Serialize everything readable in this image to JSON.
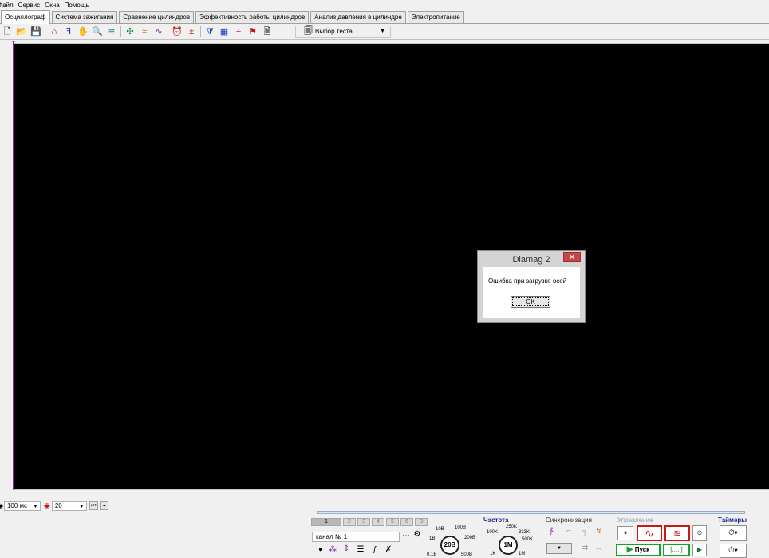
{
  "menu": [
    "Файл",
    "Сервис",
    "Окна",
    "Помощь"
  ],
  "tabs": [
    {
      "label": "Осциллограф",
      "active": true
    },
    {
      "label": "Система зажигания",
      "active": false
    },
    {
      "label": "Сравнение цилиндров",
      "active": false
    },
    {
      "label": "Эффективность работы цилиндров",
      "active": false
    },
    {
      "label": "Анализ давления в цилиндре",
      "active": false
    },
    {
      "label": "Электропитание",
      "active": false
    }
  ],
  "toolbar": {
    "test_select": "Выбор теста",
    "icons": [
      "new-file-icon",
      "open-folder-icon",
      "save-icon",
      "headphones-icon",
      "cursor-probe-icon",
      "hand-icon",
      "zoom-icon",
      "spring-icon",
      "crosshair-icon",
      "waves-icon",
      "sine-icon",
      "alarm-icon",
      "level-icon",
      "filter-icon",
      "grid-icon",
      "split-icon",
      "flag-icon",
      "document-icon"
    ]
  },
  "timebar": {
    "time_value": "100 мс",
    "count_value": "20"
  },
  "dialog": {
    "title": "Diamag 2",
    "close_glyph": "✕",
    "message": "Ошибка при загрузке осей",
    "ok_label": "OK"
  },
  "panel": {
    "channels": [
      "1",
      "2",
      "3",
      "4",
      "5",
      "6",
      "D"
    ],
    "channel_field": "канал № 1",
    "voltage": {
      "knob": "20В",
      "labels": [
        "10В",
        "100В",
        "1В",
        "200В",
        "0.1В",
        "500В"
      ]
    },
    "frequency": {
      "title": "Частота",
      "knob": "1M",
      "labels": [
        "250K",
        "100K",
        "333K",
        "500K",
        "1K",
        "1M"
      ]
    },
    "sync": {
      "title": "Синхронизация"
    },
    "control": {
      "title": "Управление",
      "start_label": "Пуск",
      "bracket_label": "[.....]"
    },
    "timers": {
      "title": "Таймеры"
    }
  },
  "colors": {
    "scope_bg": "#000000",
    "scope_marker": "#9020a0",
    "dialog_close": "#c74545"
  }
}
